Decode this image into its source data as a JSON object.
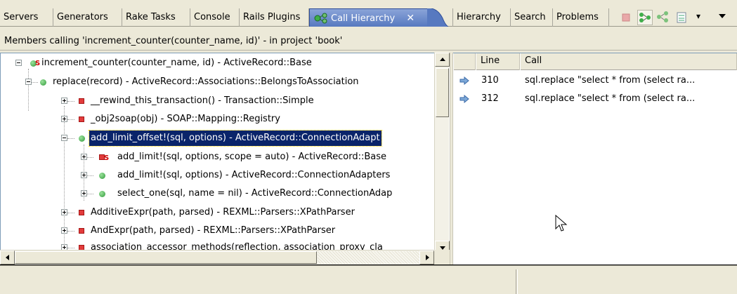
{
  "tabs": [
    {
      "label": "Servers",
      "active": false
    },
    {
      "label": "Generators",
      "active": false
    },
    {
      "label": "Rake Tasks",
      "active": false
    },
    {
      "label": "Console",
      "active": false
    },
    {
      "label": "Rails Plugins",
      "active": false
    },
    {
      "label": "Call Hierarchy",
      "active": true
    },
    {
      "label": "Hierarchy",
      "active": false
    },
    {
      "label": "Search",
      "active": false
    },
    {
      "label": "Problems",
      "active": false
    }
  ],
  "active_tab_close": "✕",
  "toolbar": {
    "icons": [
      "stop-icon",
      "callers-hierarchy-icon",
      "callees-hierarchy-icon",
      "layout-menu-icon",
      "view-menu-icon"
    ],
    "dropdown_glyph": "▾"
  },
  "header": {
    "members_text": "Members calling 'increment_counter(counter_name, id)' - in project 'book'"
  },
  "tree": {
    "items": [
      {
        "label": "increment_counter(counter_name, id) - ActiveRecord::Base",
        "icon": "static-method-icon"
      },
      {
        "label": "replace(record) - ActiveRecord::Associations::BelongsToAssociation",
        "icon": "public-method-icon"
      },
      {
        "label": "__rewind_this_transaction() - Transaction::Simple",
        "icon": "private-method-icon"
      },
      {
        "label": "_obj2soap(obj) - SOAP::Mapping::Registry",
        "icon": "private-method-icon"
      },
      {
        "label": "add_limit_offset!(sql, options) - ActiveRecord::ConnectionAdapt",
        "icon": "public-method-icon"
      },
      {
        "label": "add_limit!(sql, options, scope = auto) - ActiveRecord::Base",
        "icon": "private-static-method-icon"
      },
      {
        "label": "add_limit!(sql, options) - ActiveRecord::ConnectionAdapters",
        "icon": "public-method-icon"
      },
      {
        "label": "select_one(sql, name = nil) - ActiveRecord::ConnectionAdap",
        "icon": "public-method-icon"
      },
      {
        "label": "AdditiveExpr(path, parsed) - REXML::Parsers::XPathParser",
        "icon": "private-method-icon"
      },
      {
        "label": "AndExpr(path, parsed) - REXML::Parsers::XPathParser",
        "icon": "private-method-icon"
      },
      {
        "label": "association_accessor_methods(reflection, association_proxy_cla",
        "icon": "private-method-icon"
      }
    ],
    "static_marker": "S"
  },
  "call_table": {
    "columns": [
      "Line",
      "Call"
    ],
    "rows": [
      {
        "line": "310",
        "call": "sql.replace \"select * from (select ra..."
      },
      {
        "line": "312",
        "call": "sql.replace \"select * from (select ra..."
      }
    ]
  },
  "colors": {
    "selection": "#0a246a",
    "active_tab": "#5779c0",
    "method_public": "#2f9a3a",
    "method_private": "#e23b3b"
  }
}
